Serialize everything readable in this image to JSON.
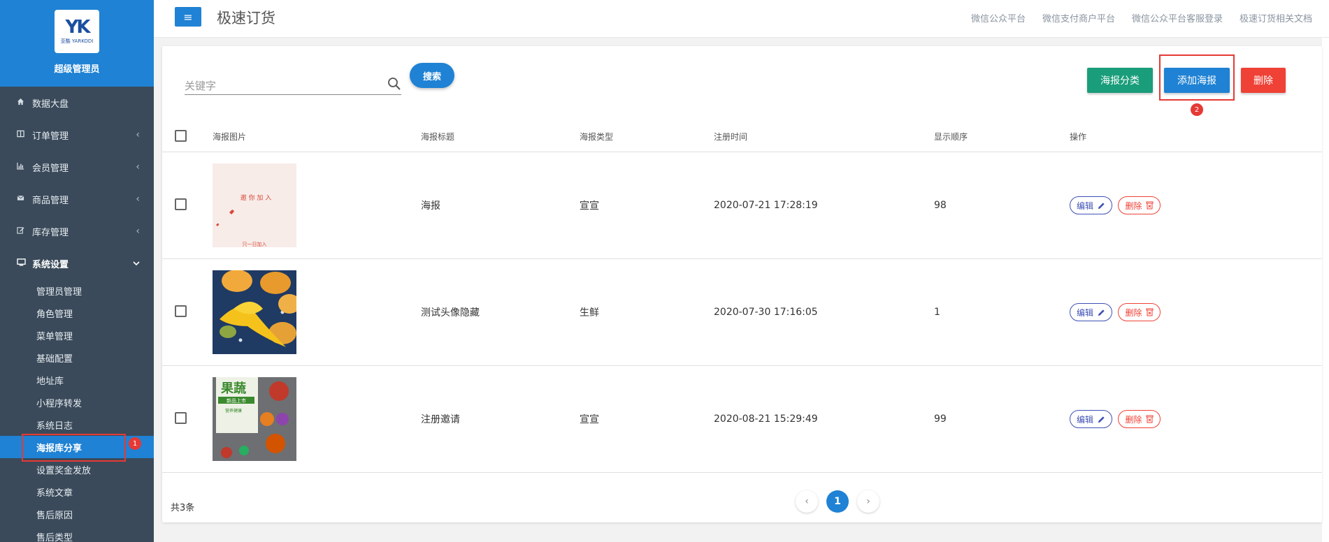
{
  "sidebar": {
    "logo": {
      "mark": "YK",
      "subtext": "亚酷 YARKODI"
    },
    "user": "超级管理员",
    "menu": [
      {
        "label": "数据大盘",
        "icon": "home-icon"
      },
      {
        "label": "订单管理",
        "icon": "columns-icon"
      },
      {
        "label": "会员管理",
        "icon": "bar-chart-icon"
      },
      {
        "label": "商品管理",
        "icon": "envelope-icon"
      },
      {
        "label": "库存管理",
        "icon": "edit-icon"
      },
      {
        "label": "系统设置",
        "icon": "monitor-icon"
      }
    ],
    "submenu": [
      "管理员管理",
      "角色管理",
      "菜单管理",
      "基础配置",
      "地址库",
      "小程序转发",
      "系统日志",
      "海报库分享",
      "设置奖金发放",
      "系统文章",
      "售后原因",
      "售后类型"
    ],
    "annotation_1": "1"
  },
  "header": {
    "menu_icon": "≡",
    "title": "极速订货",
    "links": [
      "微信公众平台",
      "微信支付商户平台",
      "微信公众平台客服登录",
      "极速订货相关文档"
    ]
  },
  "toolbar": {
    "search_placeholder": "关键字",
    "search_label": "搜索",
    "category_label": "海报分类",
    "add_label": "添加海报",
    "delete_label": "删除",
    "annotation_2": "2"
  },
  "table": {
    "columns": [
      "海报图片",
      "海报标题",
      "海报类型",
      "注册时间",
      "显示顺序",
      "操作"
    ],
    "rows": [
      {
        "title": "海报",
        "type": "宣宣",
        "time": "2020-07-21 17:28:19",
        "order": "98",
        "thumb_text": "邀 你 加 入",
        "thumb_footer": "只一日加入"
      },
      {
        "title": "测试头像隐藏",
        "type": "生鲜",
        "time": "2020-07-30 17:16:05",
        "order": "1"
      },
      {
        "title": "注册邀请",
        "type": "宣宣",
        "time": "2020-08-21 15:29:49",
        "order": "99",
        "thumb_text": "果蔬",
        "thumb_sub": "新品上市",
        "thumb_small": "营养健康"
      }
    ],
    "edit_label": "编辑",
    "delete_label": "删除"
  },
  "footer": {
    "total": "共3条",
    "current_page": "1",
    "prev": "‹",
    "next": "›"
  },
  "colors": {
    "primary": "#1f82d4",
    "sidebar": "#3a4a5a",
    "danger": "#ef4136",
    "teal": "#1a9d7a"
  }
}
